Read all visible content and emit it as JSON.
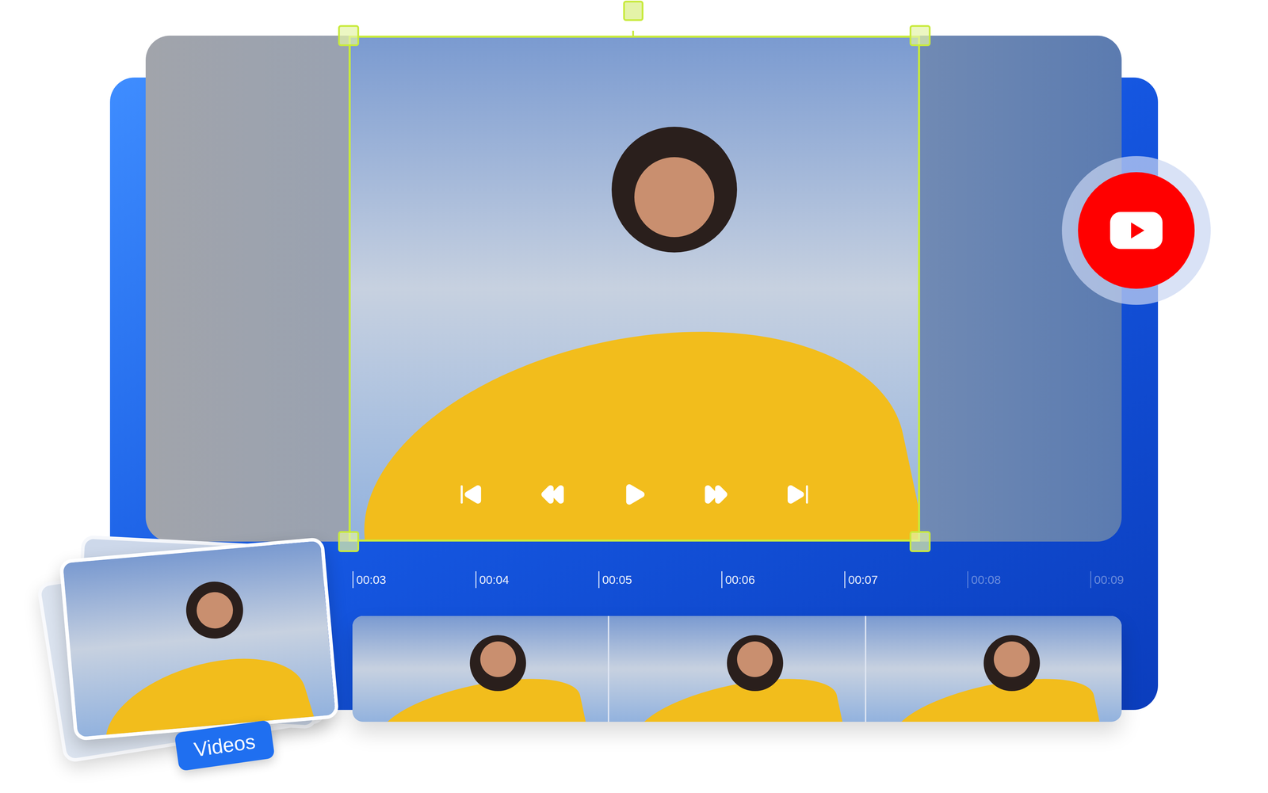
{
  "timeline": {
    "ticks": [
      {
        "label": "00:03",
        "faded": false
      },
      {
        "label": "00:04",
        "faded": false
      },
      {
        "label": "00:05",
        "faded": false
      },
      {
        "label": "00:06",
        "faded": false
      },
      {
        "label": "00:07",
        "faded": false
      },
      {
        "label": "00:08",
        "faded": true
      },
      {
        "label": "00:09",
        "faded": true
      }
    ]
  },
  "media_stack": {
    "badge": "Videos"
  }
}
